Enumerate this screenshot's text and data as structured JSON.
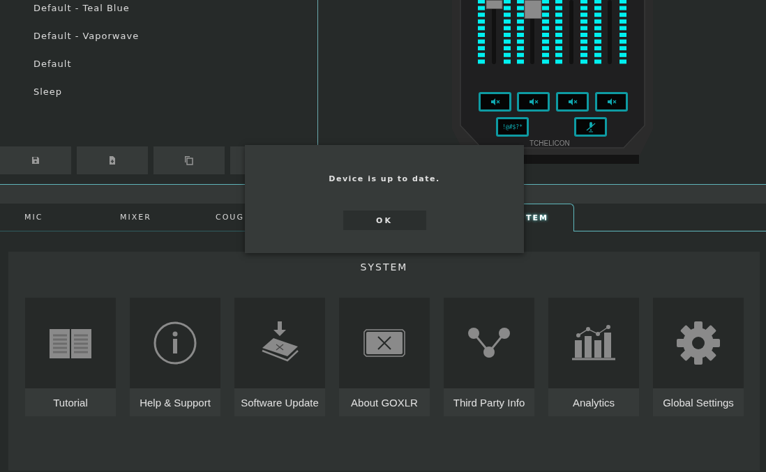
{
  "profiles": [
    "Default - Teal Blue",
    "Default - Vaporwave",
    "Default",
    "Sleep"
  ],
  "device": {
    "bleep_label": "!@#$?*",
    "logo": "TCHELICON"
  },
  "tabs": [
    {
      "label": "MIC",
      "selected": false
    },
    {
      "label": "MIXER",
      "selected": false
    },
    {
      "label": "COUG",
      "selected": false
    },
    {
      "label": "TEM",
      "selected": true
    }
  ],
  "dialog": {
    "message": "Device is up to date.",
    "button": "OK"
  },
  "system": {
    "title": "SYSTEM",
    "items": [
      {
        "label": "Tutorial",
        "kind": "book"
      },
      {
        "label": "Help & Support",
        "kind": "info"
      },
      {
        "label": "Software Update",
        "kind": "update"
      },
      {
        "label": "About GOXLR",
        "kind": "about"
      },
      {
        "label": "Third Party Info",
        "kind": "share"
      },
      {
        "label": "Analytics",
        "kind": "analytics"
      },
      {
        "label": "Global Settings",
        "kind": "settings"
      }
    ]
  }
}
